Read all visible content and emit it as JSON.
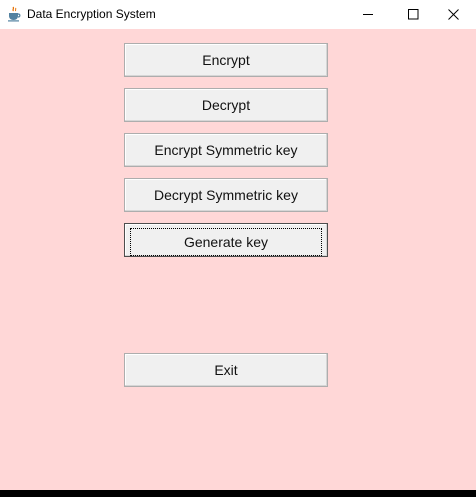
{
  "window": {
    "title": "Data Encryption System",
    "icon": "java-cup-icon",
    "controls": [
      "minimize-icon",
      "maximize-icon",
      "close-icon"
    ]
  },
  "buttons": {
    "encrypt": "Encrypt",
    "decrypt": "Decrypt",
    "encrypt_symmetric_key": "Encrypt Symmetric key",
    "decrypt_symmetric_key": "Decrypt Symmetric key",
    "generate_key": "Generate key",
    "exit": "Exit"
  },
  "colors": {
    "background": "#ffd7d7",
    "button_face": "#f0f0f0",
    "titlebar": "#ffffff"
  }
}
